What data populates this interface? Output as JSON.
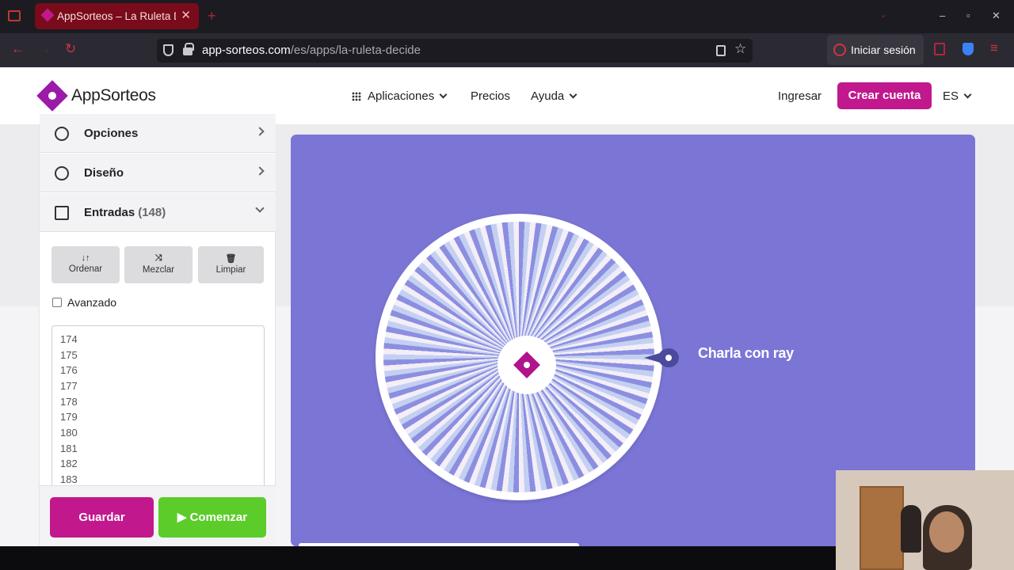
{
  "browser": {
    "tab_title": "AppSorteos – La Ruleta Decide",
    "tab_close": "✕",
    "new_tab": "+",
    "url_domain": "app-sorteos.com",
    "url_path": "/es/apps/la-ruleta-decide",
    "signin_label": "Iniciar sesión",
    "nav_back": "←",
    "nav_forward": "→",
    "nav_reload": "↻",
    "menu": "≡",
    "win_min": "–",
    "win_max": "▫",
    "win_close": "✕",
    "tab_list": "⌄",
    "star": "☆"
  },
  "header": {
    "logo_prefix": "App",
    "logo_suffix": "Sorteos",
    "nav": {
      "apps": "Aplicaciones",
      "pricing": "Precios",
      "help": "Ayuda"
    },
    "login": "Ingresar",
    "create_account": "Crear cuenta",
    "language": "ES"
  },
  "sidebar": {
    "options_label": "Opciones",
    "design_label": "Diseño",
    "entries_label": "Entradas",
    "entries_count": "(148)",
    "tools": {
      "sort_icon": "↓↑",
      "sort_label": "Ordenar",
      "shuffle_icon": "⤨",
      "shuffle_label": "Mezclar",
      "clear_icon": "🗑",
      "clear_label": "Limpiar"
    },
    "advanced_label": "Avanzado",
    "entries": [
      "174",
      "175",
      "176",
      "177",
      "178",
      "179",
      "180",
      "181",
      "182",
      "183"
    ],
    "save_label": "Guardar",
    "start_label": "▶ Comenzar"
  },
  "wheel": {
    "result_text": "Charla con ray"
  },
  "colors": {
    "brand": "#c2188d",
    "start": "#5ccc2a",
    "panel": "#7b75d6"
  }
}
